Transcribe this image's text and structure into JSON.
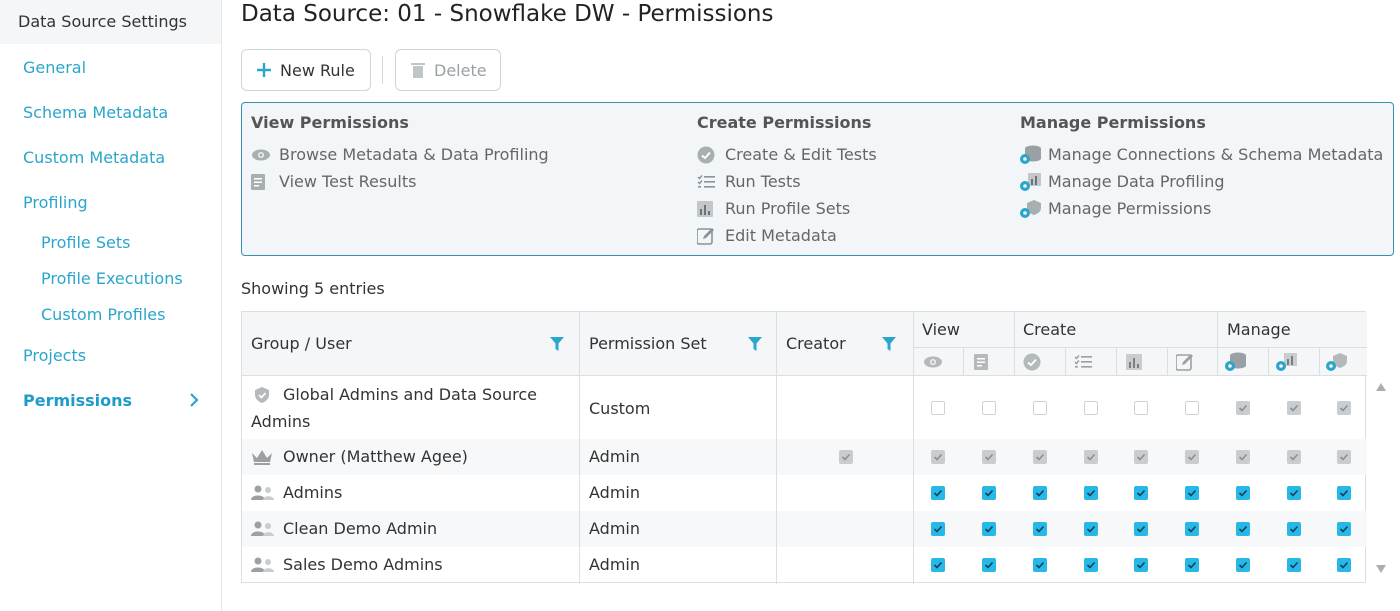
{
  "sidebar": {
    "header": "Data Source Settings",
    "items": [
      {
        "label": "General"
      },
      {
        "label": "Schema Metadata"
      },
      {
        "label": "Custom Metadata"
      },
      {
        "label": "Profiling"
      },
      {
        "label": "Profile Sets"
      },
      {
        "label": "Profile Executions"
      },
      {
        "label": "Custom Profiles"
      },
      {
        "label": "Projects"
      },
      {
        "label": "Permissions"
      }
    ]
  },
  "page": {
    "title": "Data Source: 01 - Snowflake DW - Permissions",
    "new_rule": "New Rule",
    "delete": "Delete",
    "showing": "Showing 5 entries"
  },
  "legend": {
    "view": {
      "title": "View Permissions",
      "items": [
        {
          "label": "Browse Metadata & Data Profiling",
          "icon": "eye-icon"
        },
        {
          "label": "View Test Results",
          "icon": "document-icon"
        }
      ]
    },
    "create": {
      "title": "Create Permissions",
      "items": [
        {
          "label": "Create & Edit Tests",
          "icon": "check-circle-icon"
        },
        {
          "label": "Run Tests",
          "icon": "checklist-icon"
        },
        {
          "label": "Run Profile Sets",
          "icon": "bar-chart-icon"
        },
        {
          "label": "Edit Metadata",
          "icon": "edit-icon"
        }
      ]
    },
    "manage": {
      "title": "Manage Permissions",
      "items": [
        {
          "label": "Manage Connections & Schema Metadata",
          "icon": "database-gear-icon"
        },
        {
          "label": "Manage Data Profiling",
          "icon": "chart-gear-icon"
        },
        {
          "label": "Manage Permissions",
          "icon": "shield-gear-icon"
        }
      ]
    }
  },
  "table": {
    "columns": {
      "group_user": "Group / User",
      "permission_set": "Permission Set",
      "creator": "Creator",
      "view": "View",
      "create": "Create",
      "manage": "Manage"
    },
    "rows": [
      {
        "name": "Global Admins and Data Source",
        "name_line2": "Admins",
        "icon": "shield-icon",
        "permission_set": "Custom",
        "creator": "none",
        "perms": [
          "off",
          "off",
          "off",
          "off",
          "off",
          "off",
          "grey",
          "grey",
          "grey"
        ]
      },
      {
        "name": "Owner (Matthew Agee)",
        "icon": "crown-icon",
        "permission_set": "Admin",
        "creator": "grey",
        "perms": [
          "grey",
          "grey",
          "grey",
          "grey",
          "grey",
          "grey",
          "grey",
          "grey",
          "grey"
        ]
      },
      {
        "name": "Admins",
        "icon": "users-icon",
        "permission_set": "Admin",
        "creator": "none",
        "perms": [
          "blue",
          "blue",
          "blue",
          "blue",
          "blue",
          "blue",
          "blue",
          "blue",
          "blue"
        ]
      },
      {
        "name": "Clean Demo Admin",
        "icon": "users-icon",
        "permission_set": "Admin",
        "creator": "none",
        "perms": [
          "blue",
          "blue",
          "blue",
          "blue",
          "blue",
          "blue",
          "blue",
          "blue",
          "blue"
        ]
      },
      {
        "name": "Sales Demo Admins",
        "icon": "users-icon",
        "permission_set": "Admin",
        "creator": "none",
        "perms": [
          "blue",
          "blue",
          "blue",
          "blue",
          "blue",
          "blue",
          "blue",
          "blue",
          "blue"
        ]
      }
    ]
  },
  "colors": {
    "accent": "#2aa5cc",
    "check_blue": "#28b8e8",
    "check_grey": "#c9cdd0",
    "box_border": "#3a8fb0"
  }
}
